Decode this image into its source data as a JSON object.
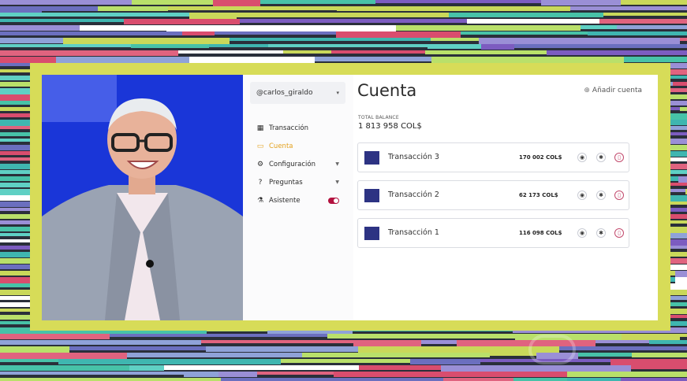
{
  "sidebar": {
    "user": "@carlos_giraldo",
    "items": [
      {
        "label": "Transacción",
        "icon": "grid-icon",
        "active": false,
        "caret": false,
        "toggle": false
      },
      {
        "label": "Cuenta",
        "icon": "card-icon",
        "active": true,
        "caret": false,
        "toggle": false
      },
      {
        "label": "Configuración",
        "icon": "gear-icon",
        "active": false,
        "caret": true,
        "toggle": false
      },
      {
        "label": "Preguntas",
        "icon": "question-icon",
        "active": false,
        "caret": true,
        "toggle": false
      },
      {
        "label": "Asistente",
        "icon": "flask-icon",
        "active": false,
        "caret": false,
        "toggle": true
      }
    ]
  },
  "main": {
    "title": "Cuenta",
    "add_label": "Añadir cuenta",
    "balance_label": "TOTAL BALANCE",
    "balance_value": "1 813 958 COL$",
    "transactions": [
      {
        "name": "Transacción 3",
        "amount": "170 002 COL$"
      },
      {
        "name": "Transacción 2",
        "amount": "62 173 COL$"
      },
      {
        "name": "Transacción 1",
        "amount": "116 098 COL$"
      }
    ]
  },
  "colors": {
    "accent": "#e3a11d",
    "toggle": "#b3123f",
    "frame": "#d7dc58",
    "video_bg": "#1a36d8"
  }
}
